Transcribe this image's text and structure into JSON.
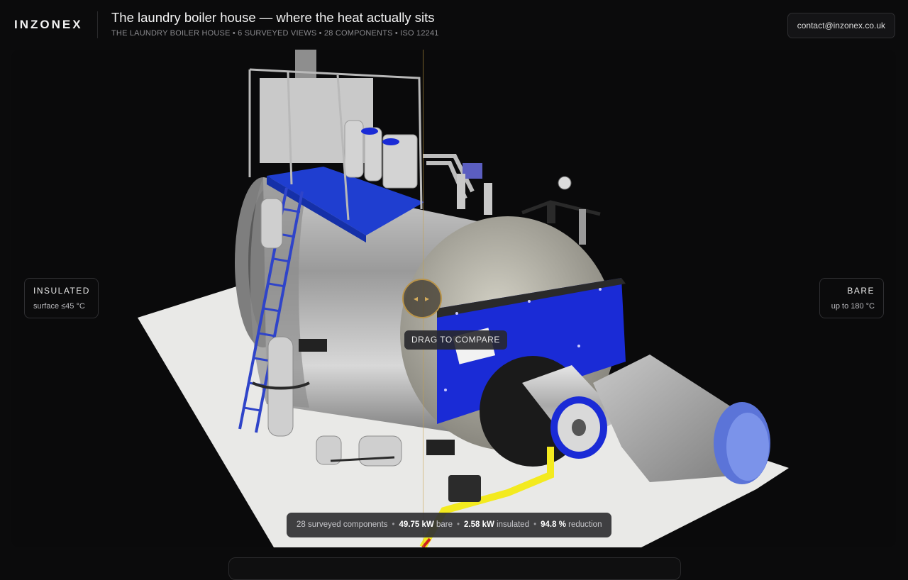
{
  "header": {
    "brand": "INZONEX",
    "title": "The laundry boiler house — where the heat actually sits",
    "subtitle": "THE LAUNDRY BOILER HOUSE • 6 SURVEYED VIEWS • 28 COMPONENTS • ISO 12241",
    "contact": "contact@inzonex.co.uk"
  },
  "compare": {
    "left": {
      "title": "INSULATED",
      "sub": "surface ≤45 °C"
    },
    "right": {
      "title": "BARE",
      "sub": "up to 180 °C"
    },
    "drag_label": "DRAG TO COMPARE",
    "handle_left_icon": "chevron-left-icon",
    "handle_right_icon": "chevron-right-icon"
  },
  "stats": {
    "components": "28 surveyed components",
    "bare_value": "49.75 kW",
    "bare_label": "bare",
    "insulated_value": "2.58 kW",
    "insulated_label": "insulated",
    "reduction_value": "94.8 %",
    "reduction_label": "reduction",
    "separator": "•"
  },
  "colors": {
    "accent": "#b9944a",
    "background": "#0b0b0c",
    "boiler_blue": "#1a2bd6"
  }
}
